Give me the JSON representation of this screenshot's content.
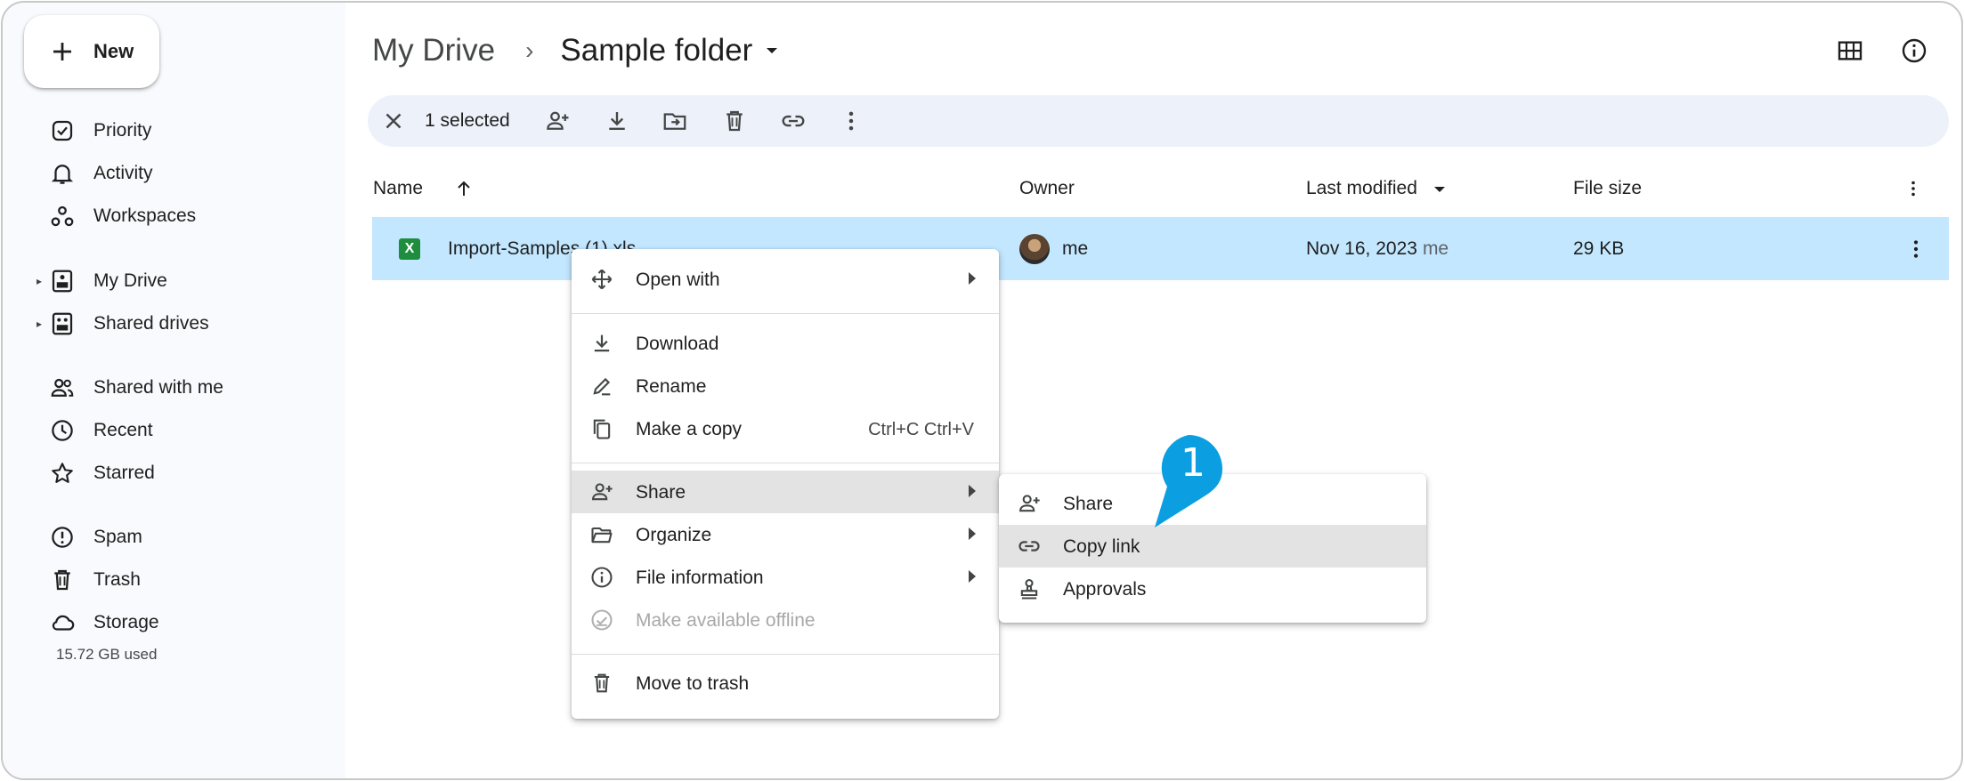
{
  "sidebar": {
    "new_label": "New",
    "items": [
      {
        "label": "Priority",
        "icon": "priority-icon"
      },
      {
        "label": "Activity",
        "icon": "bell-icon"
      },
      {
        "label": "Workspaces",
        "icon": "workspaces-icon"
      },
      {
        "label": "My Drive",
        "icon": "my-drive-icon"
      },
      {
        "label": "Shared drives",
        "icon": "shared-drives-icon"
      },
      {
        "label": "Shared with me",
        "icon": "people-icon"
      },
      {
        "label": "Recent",
        "icon": "clock-icon"
      },
      {
        "label": "Starred",
        "icon": "star-icon"
      },
      {
        "label": "Spam",
        "icon": "spam-icon"
      },
      {
        "label": "Trash",
        "icon": "trash-icon"
      },
      {
        "label": "Storage",
        "icon": "cloud-icon"
      }
    ],
    "storage_used": "15.72 GB used"
  },
  "breadcrumb": {
    "root": "My Drive",
    "separator": "›",
    "current": "Sample folder"
  },
  "actionbar": {
    "selected_count": "1 selected"
  },
  "table": {
    "columns": {
      "name": "Name",
      "owner": "Owner",
      "modified": "Last modified",
      "size": "File size"
    },
    "rows": [
      {
        "name": "Import-Samples (1).xls",
        "file_icon": "X",
        "owner": "me",
        "modified": "Nov 16, 2023",
        "modified_by": "me",
        "size": "29 KB"
      }
    ]
  },
  "context_menu": {
    "open_with": "Open with",
    "download": "Download",
    "rename": "Rename",
    "make_copy": "Make a copy",
    "make_copy_shortcut": "Ctrl+C Ctrl+V",
    "share": "Share",
    "organize": "Organize",
    "file_information": "File information",
    "make_offline": "Make available offline",
    "move_to_trash": "Move to trash"
  },
  "share_submenu": {
    "share": "Share",
    "copy_link": "Copy link",
    "approvals": "Approvals"
  },
  "callout": {
    "number": "1",
    "color": "#0b9ee0"
  },
  "colors": {
    "selected_row": "#c2e7ff",
    "sidebar_bg": "#f8fafd",
    "actionbar_bg": "#edf2fa"
  }
}
